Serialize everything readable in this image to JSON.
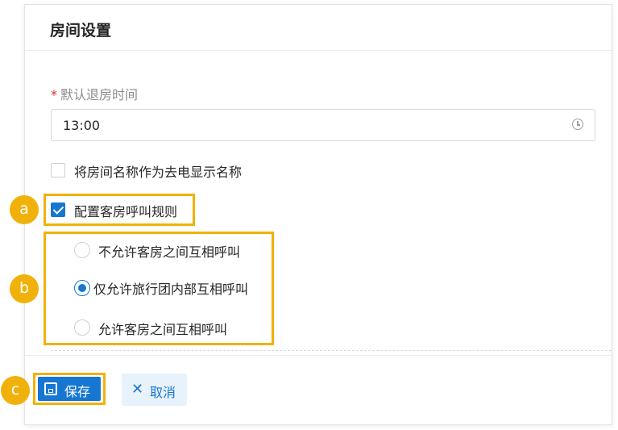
{
  "panel": {
    "title": "房间设置"
  },
  "checkout_time": {
    "required_mark": "*",
    "label": "默认退房时间",
    "value": "13:00",
    "icon": "clock-icon"
  },
  "options": {
    "use_room_name_as_caller_id": {
      "label": "将房间名称作为去电显示名称",
      "checked": false
    },
    "configure_call_rules": {
      "label": "配置客房呼叫规则",
      "checked": true
    }
  },
  "call_rules": [
    {
      "label": "不允许客房之间互相呼叫",
      "selected": false
    },
    {
      "label": "仅允许旅行团内部互相呼叫",
      "selected": true
    },
    {
      "label": "允许客房之间互相呼叫",
      "selected": false
    }
  ],
  "footer": {
    "save_label": "保存",
    "save_icon": "save-icon",
    "cancel_label": "取消",
    "cancel_icon": "close-icon"
  },
  "annotations": {
    "a": "a",
    "b": "b",
    "c": "c"
  },
  "colors": {
    "accent": "#1677d2",
    "highlight": "#f1b10b",
    "required": "#f5222d"
  }
}
